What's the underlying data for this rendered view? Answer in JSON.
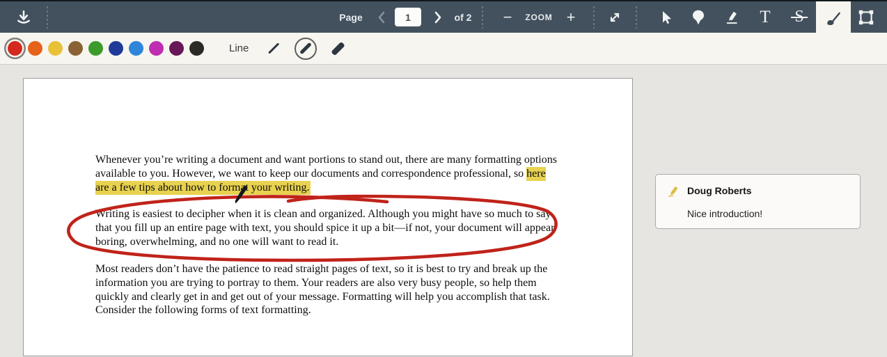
{
  "toolbar": {
    "page_label": "Page",
    "page_input_value": "1",
    "page_count_label": "of 2",
    "zoom_label": "ZOOM",
    "zoom_out_glyph": "−",
    "zoom_in_glyph": "+",
    "text_tool_glyph": "T",
    "strikethrough_glyph": "S"
  },
  "draw_toolbar": {
    "line_label": "Line",
    "colors": [
      "#d3291f",
      "#e6611a",
      "#e9c137",
      "#8a6233",
      "#3c9b2a",
      "#1e3b99",
      "#2e85da",
      "#bf2db2",
      "#681758",
      "#2b2a27"
    ],
    "selected_color": "#d3291f",
    "stroke_options": [
      "thin",
      "medium",
      "thick"
    ],
    "selected_stroke": "medium"
  },
  "document": {
    "paragraph1_pre": "Whenever you’re writing a document and want portions to stand out, there are many formatting options available to you. However, we want to keep our documents and correspondence professional, so ",
    "paragraph1_highlight": "here are a few tips about how to format your writing.",
    "paragraph2": "Writing is easiest to decipher when it is clean and organized. Although you might have so much to say that you fill up an entire page with text, you should spice it up a bit—if not, your document will appear boring, overwhelming, and no one will want to read it.",
    "paragraph3": "Most readers don’t have the patience to read straight pages of text, so it is best to try and break up the information you are trying to portray to them. Your readers are also very busy people, so help them quickly and clearly get in and get out of your message. Formatting will help you accomplish that task. Consider the following forms of text formatting."
  },
  "annotation_colors": {
    "highlight": "#e8d24f",
    "ellipse": "#c0231a",
    "pencil": "#15181b"
  },
  "comment": {
    "author": "Doug Roberts",
    "text": "Nice introduction!"
  }
}
